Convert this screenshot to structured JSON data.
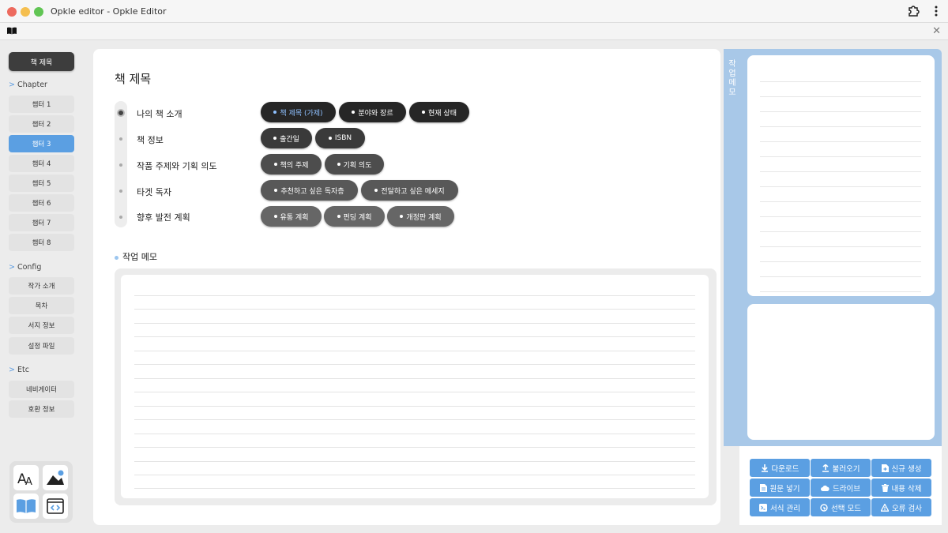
{
  "window": {
    "title": "Opkle editor - Opkle Editor"
  },
  "sidebar": {
    "book_title_button": "책 제목",
    "sections": {
      "chapter": {
        "arrow": ">",
        "label": "Chapter"
      },
      "config": {
        "arrow": ">",
        "label": "Config"
      },
      "etc": {
        "arrow": ">",
        "label": "Etc"
      }
    },
    "chapters": [
      "챕터 1",
      "챕터 2",
      "챕터 3",
      "챕터 4",
      "챕터 5",
      "챕터 6",
      "챕터 7",
      "챕터 8"
    ],
    "active_chapter": "챕터 3",
    "config_items": [
      "작가 소개",
      "목차",
      "서지 정보",
      "설정 파일"
    ],
    "etc_items": [
      "네비게이터",
      "호환 정보"
    ],
    "tools": [
      "font-icon",
      "image-icon",
      "book-icon",
      "code-icon"
    ]
  },
  "main": {
    "title": "책 제목",
    "rows": [
      {
        "label": "나의 책 소개",
        "pills": [
          "책 제목 (가제)",
          "분야와 장르",
          "현재 상태"
        ]
      },
      {
        "label": "책 정보",
        "pills": [
          "출간일",
          "ISBN"
        ]
      },
      {
        "label": "작품 주제와 기획 의도",
        "pills": [
          "책의 주제",
          "기획 의도"
        ]
      },
      {
        "label": "타겟 독자",
        "pills": [
          "추천하고 싶은 독자층",
          "전달하고 싶은 메세지"
        ]
      },
      {
        "label": "향후 발전 계획",
        "pills": [
          "유통 계획",
          "펀딩 계획",
          "개정판 계획"
        ]
      }
    ],
    "selected_pill": "책 제목 (가제)",
    "memo_label": "작업 메모"
  },
  "right_panel": {
    "tab_label": "작업 메모",
    "actions": [
      "다운로드",
      "불러오기",
      "신규 생성",
      "원문 넣기",
      "드라이브",
      "내용 삭제",
      "서식 관리",
      "선택 모드",
      "오류 검사"
    ]
  },
  "colors": {
    "accent": "#5b9fe2",
    "panel": "#a8c8e8",
    "pill_dark": "#262626",
    "selected_text": "#8ec0ff"
  }
}
